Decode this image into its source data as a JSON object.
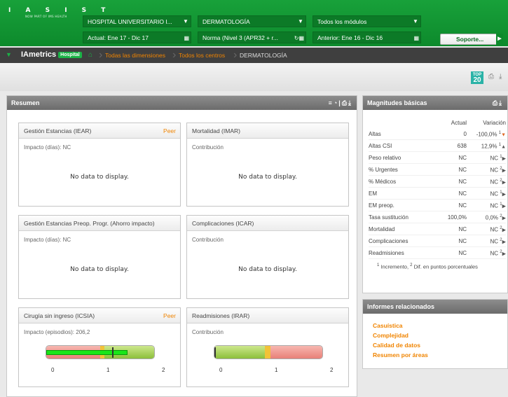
{
  "header": {
    "logo_text": "I A S I S T",
    "logo_sub": "NOW PART OF IMS HEALTH",
    "hospital": "HOSPITAL UNIVERSITARIO I...",
    "service": "DERMATOLOGÍA",
    "modules": "Todos los módulos",
    "period_actual": "Actual: Ene 17 - Dic 17",
    "norma": "Norma (Nivel 3 (APR32 + r...",
    "period_anterior": "Anterior: Ene 16 - Dic 16",
    "support": "Soporte..."
  },
  "nav": {
    "brand": "IAmetrics",
    "badge": "Hospital",
    "crumbs": [
      "Todas las dimensiones",
      "Todos los centros",
      "DERMATOLOGÍA"
    ]
  },
  "toolbar": {
    "top_label": "TOP",
    "top_number": "20"
  },
  "resumen": {
    "title": "Resumen",
    "cards": [
      {
        "title": "Gestión Estancias (IEAR)",
        "peer": "Peer",
        "sub": "Impacto (días):  NC",
        "nodata": "No data to display."
      },
      {
        "title": "Mortalidad (IMAR)",
        "peer": "",
        "sub": "Contribución",
        "nodata": "No data to display."
      },
      {
        "title": "Gestión Estancias Preop. Progr. (Ahorro impacto)",
        "peer": "",
        "sub": "Impacto (días):  NC",
        "nodata": "No data to display."
      },
      {
        "title": "Complicaciones (ICAR)",
        "peer": "",
        "sub": "Contribución",
        "nodata": "No data to display."
      },
      {
        "title": "Cirugía sin ingreso (ICSIA)",
        "peer": "Peer",
        "sub": "Impacto (episodios):  206,2"
      },
      {
        "title": "Readmisiones (IRAR)",
        "peer": "",
        "sub": "Contribución"
      }
    ],
    "gauge_icsia": {
      "value": 1.5,
      "marker": 1.22,
      "min": 0,
      "max": 2,
      "ticks": [
        "0",
        "1",
        "2"
      ]
    },
    "gauge_irar": {
      "min": 0,
      "max": 2,
      "ticks": [
        "0",
        "1",
        "2"
      ]
    }
  },
  "magnitudes": {
    "title": "Magnitudes básicas",
    "col_actual": "Actual",
    "col_variacion": "Variación",
    "rows": [
      {
        "label": "Altas",
        "actual": "0",
        "var": "-100,0%",
        "sup": "1",
        "arrow": "▼"
      },
      {
        "label": "Altas CSI",
        "actual": "638",
        "var": "12,9%",
        "sup": "1",
        "arrow": "▲"
      },
      {
        "label": "Peso relativo",
        "actual": "NC",
        "var": "NC",
        "sup": "1",
        "arrow": "▶"
      },
      {
        "label": "% Urgentes",
        "actual": "NC",
        "var": "NC",
        "sup": "2",
        "arrow": "▶"
      },
      {
        "label": "% Médicos",
        "actual": "NC",
        "var": "NC",
        "sup": "2",
        "arrow": "▶"
      },
      {
        "label": "EM",
        "actual": "NC",
        "var": "NC",
        "sup": "1",
        "arrow": "▶"
      },
      {
        "label": "EM preop.",
        "actual": "NC",
        "var": "NC",
        "sup": "1",
        "arrow": "▶"
      },
      {
        "label": "Tasa sustitución",
        "actual": "100,0%",
        "var": "0,0%",
        "sup": "2",
        "arrow": "▶"
      },
      {
        "label": "Mortalidad",
        "actual": "NC",
        "var": "NC",
        "sup": "2",
        "arrow": "▶"
      },
      {
        "label": "Complicaciones",
        "actual": "NC",
        "var": "NC",
        "sup": "2",
        "arrow": "▶"
      },
      {
        "label": "Readmisiones",
        "actual": "NC",
        "var": "NC",
        "sup": "2",
        "arrow": "▶"
      }
    ],
    "footnote_1": "1",
    "footnote_1_text": "Incremento,",
    "footnote_2": "2",
    "footnote_2_text": "Dif. en puntos porcentuales"
  },
  "informes": {
    "title": "Informes relacionados",
    "links": [
      "Casuística",
      "Complejidad",
      "Calidad de datos",
      "Resumen por áreas"
    ]
  }
}
